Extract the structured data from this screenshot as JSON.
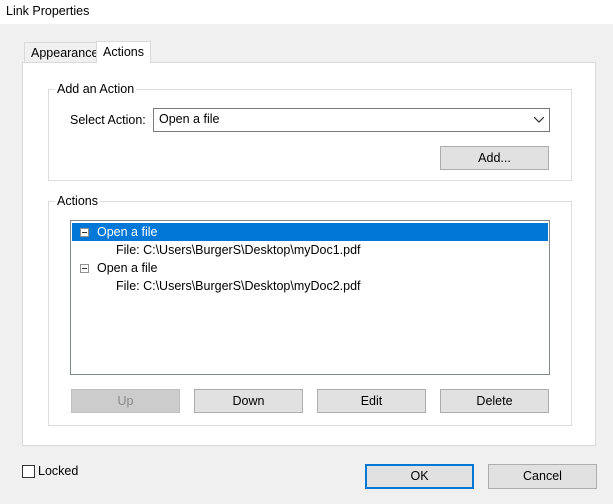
{
  "window": {
    "title": "Link Properties"
  },
  "tabs": [
    {
      "label": "Appearance",
      "active": false
    },
    {
      "label": "Actions",
      "active": true
    }
  ],
  "add_action": {
    "group_label": "Add an Action",
    "select_label": "Select Action:",
    "select_value": "Open a file",
    "add_button": "Add..."
  },
  "actions": {
    "group_label": "Actions",
    "items": [
      {
        "label": "Open a file",
        "detail": "File: C:\\Users\\BurgerS\\Desktop\\myDoc1.pdf",
        "selected": true
      },
      {
        "label": "Open a file",
        "detail": "File: C:\\Users\\BurgerS\\Desktop\\myDoc2.pdf",
        "selected": false
      }
    ],
    "buttons": {
      "up": "Up",
      "down": "Down",
      "edit": "Edit",
      "delete": "Delete"
    }
  },
  "footer": {
    "locked_label": "Locked",
    "locked_checked": false,
    "ok": "OK",
    "cancel": "Cancel"
  },
  "colors": {
    "accent": "#0078d7"
  }
}
